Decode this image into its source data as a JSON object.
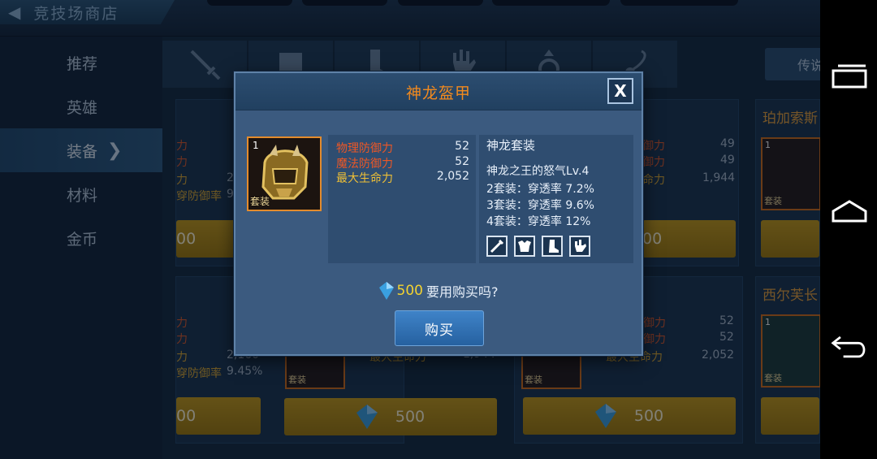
{
  "header": {
    "title": "竞技场商店",
    "back_arrow": "◀"
  },
  "sidebar": {
    "items": [
      {
        "label": "推荐"
      },
      {
        "label": "英雄"
      },
      {
        "label": "装备",
        "chevron": "❯"
      },
      {
        "label": "材料"
      },
      {
        "label": "金币"
      }
    ]
  },
  "filter_tabs": [
    "sword-icon",
    "chest-icon",
    "boots-icon",
    "glove-icon",
    "ring-icon",
    "amulet-icon"
  ],
  "legend_button": "传说",
  "cards": [
    {
      "name": "",
      "stats": [
        {
          "label": "力",
          "value": ""
        },
        {
          "label": "力",
          "value": ""
        },
        {
          "label": "力",
          "value": "2"
        },
        {
          "label": "穿防御率",
          "value": "9"
        }
      ],
      "price": "00"
    },
    {
      "name": "",
      "stats": [
        {
          "label": "御力",
          "value": "49"
        },
        {
          "label": "御力",
          "value": "49"
        },
        {
          "label": "命力",
          "value": "1,944"
        }
      ],
      "price": "00"
    },
    {
      "name": "珀加索斯",
      "price": ""
    },
    {
      "name": "",
      "stats": [
        {
          "label": "力",
          "value": ""
        },
        {
          "label": "力",
          "value": ""
        },
        {
          "label": "力",
          "value": "2,160"
        },
        {
          "label": "穿防御率",
          "value": "9.45%"
        }
      ],
      "price": "00"
    },
    {
      "name": "",
      "stats": [
        {
          "label": "最大生命力",
          "value": "1,944"
        }
      ],
      "tag": "套装",
      "price": "500"
    },
    {
      "name": "",
      "stats": [
        {
          "label": "御力",
          "value": "52"
        },
        {
          "label": "御力",
          "value": "52"
        },
        {
          "label": "最大生命力",
          "value": "2,052"
        }
      ],
      "tag": "套装",
      "price": "500"
    },
    {
      "name": "西尔芙长",
      "lvl": "1",
      "tag": "套装",
      "price": ""
    }
  ],
  "modal": {
    "title": "神龙盔甲",
    "close": "X",
    "item": {
      "level": "1",
      "tag": "套装"
    },
    "stats": [
      {
        "label": "物理防御力",
        "value": "52",
        "color": "#ec5726"
      },
      {
        "label": "魔法防御力",
        "value": "52",
        "color": "#ec5726"
      },
      {
        "label": "最大生命力",
        "value": "2,052",
        "color": "#eebf36"
      }
    ],
    "set": {
      "title": "神龙套装",
      "subtitle": "神龙之王的怒气Lv.4",
      "bonuses": [
        "2套装：穿透率 7.2%",
        "3套装：穿透率 9.6%",
        "4套装：穿透率 12%"
      ],
      "piece_icons": [
        "sword-piece-icon",
        "armor-piece-icon",
        "boots-piece-icon",
        "glove-piece-icon"
      ]
    },
    "confirm": {
      "amount": "500",
      "text": "要用购买吗?"
    },
    "buy_label": "购买"
  },
  "colors": {
    "accent_orange": "#f28a1e",
    "gem_blue": "#3aa0e0",
    "price_gold": "#c59a1a"
  }
}
